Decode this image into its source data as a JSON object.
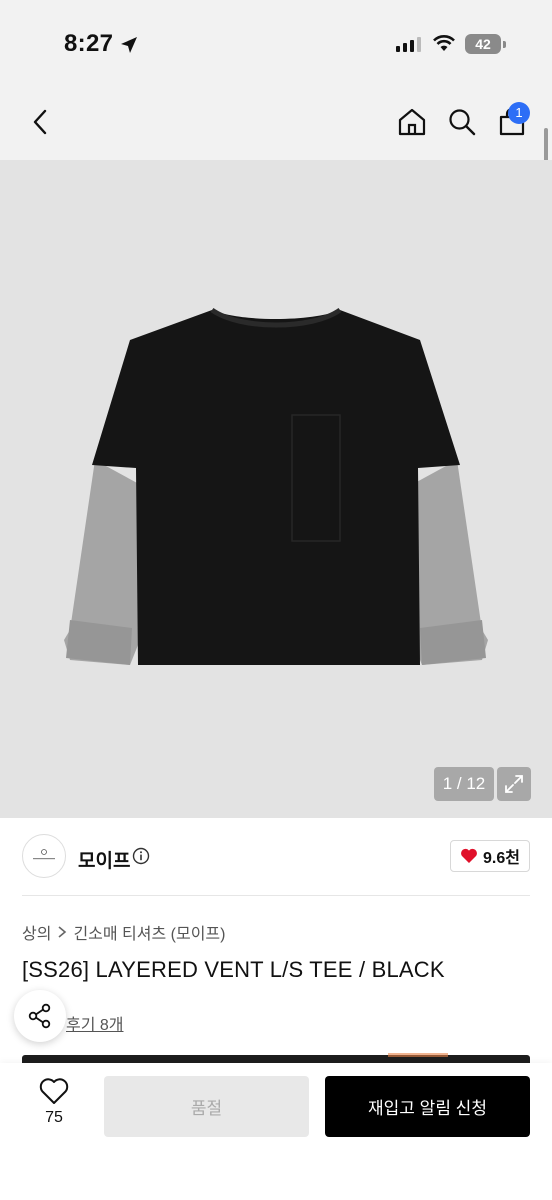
{
  "status_bar": {
    "time": "8:27",
    "battery": "42",
    "icons": [
      "location-arrow-icon",
      "signal-icon",
      "wifi-icon",
      "battery-icon"
    ]
  },
  "nav": {
    "cart_badge": "1",
    "icons": [
      "back-icon",
      "home-icon",
      "search-icon",
      "cart-icon"
    ]
  },
  "gallery": {
    "counter": "1 / 12",
    "background_color": "#e3e3e3"
  },
  "brand": {
    "name": "모이프",
    "like_count": "9.6천",
    "heart_color": "#e0102a"
  },
  "breadcrumb": {
    "items": [
      "상의",
      "긴소매 티셔츠 (모이프)"
    ]
  },
  "product": {
    "title": "[SS26] LAYERED VENT L/S TEE / BLACK",
    "review_link": "후기 8개"
  },
  "bottom_bar": {
    "wish_count": "75",
    "soldout_label": "품절",
    "restock_label": "재입고 알림 신청"
  },
  "colors": {
    "accent_badge": "#2d6ef6",
    "primary_button": "#000000"
  }
}
